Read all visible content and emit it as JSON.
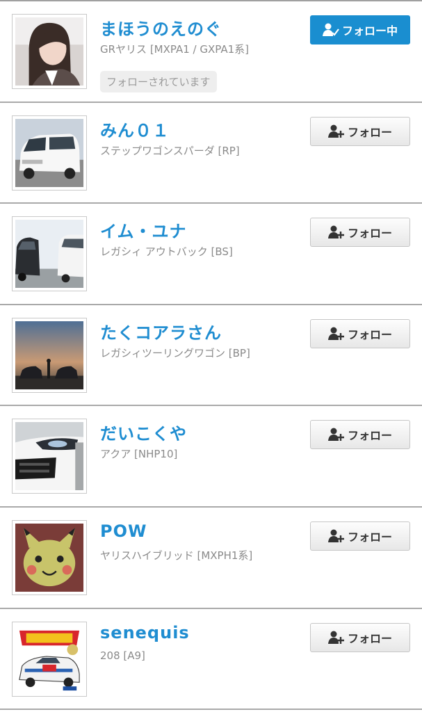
{
  "users": [
    {
      "name": "まほうのえのぐ",
      "car": "GRヤリス [MXPA1 / GXPA1系]",
      "badge": "フォローされています",
      "button": "フォロー中",
      "following": true,
      "avatar": "portrait-photo"
    },
    {
      "name": "みん０１",
      "car": "ステップワゴンスパーダ [RP]",
      "button": "フォロー",
      "following": false,
      "avatar": "white-minivan-photo"
    },
    {
      "name": "イム・ユナ",
      "car": "レガシィ アウトバック [BS]",
      "button": "フォロー",
      "following": false,
      "avatar": "parked-cars-photo"
    },
    {
      "name": "たくコアラさん",
      "car": "レガシィツーリングワゴン [BP]",
      "button": "フォロー",
      "following": false,
      "avatar": "sunset-cars-photo"
    },
    {
      "name": "だいこくや",
      "car": "アクア [NHP10]",
      "button": "フォロー",
      "following": false,
      "avatar": "car-headlight-photo"
    },
    {
      "name": "POW",
      "car": "ヤリスハイブリッド [MXPH1系]",
      "button": "フォロー",
      "following": false,
      "avatar": "pikachu-art"
    },
    {
      "name": "senequis",
      "car": "208 [A9]",
      "button": "フォロー",
      "following": false,
      "avatar": "sega-rally-box-art"
    }
  ],
  "icons": {
    "following": "user-check-icon",
    "follow": "user-plus-icon"
  },
  "colors": {
    "accent": "#1f8dd1",
    "button_on": "#1a8ed0"
  }
}
